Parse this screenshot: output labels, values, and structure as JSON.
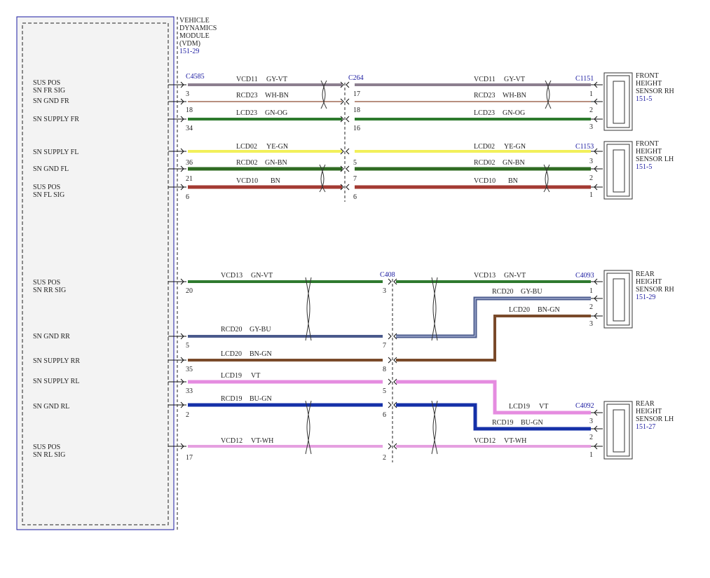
{
  "module": {
    "lines": [
      "VEHICLE",
      "DYNAMICS",
      "MODULE",
      "(VDM)"
    ],
    "ref": "151-29",
    "pins": [
      {
        "label1": "SUS POS",
        "label2": "SN FR SIG"
      },
      {
        "label1": "SN GND FR",
        "label2": ""
      },
      {
        "label1": "SN SUPPLY FR",
        "label2": ""
      },
      {
        "label1": "SN SUPPLY FL",
        "label2": ""
      },
      {
        "label1": "SN GND FL",
        "label2": ""
      },
      {
        "label1": "SUS POS",
        "label2": "SN FL SIG"
      },
      {
        "label1": "SUS POS",
        "label2": "SN RR SIG"
      },
      {
        "label1": "SN GND RR",
        "label2": ""
      },
      {
        "label1": "SN SUPPLY RR",
        "label2": ""
      },
      {
        "label1": "SN SUPPLY RL",
        "label2": ""
      },
      {
        "label1": "SN GND RL",
        "label2": ""
      },
      {
        "label1": "SUS POS",
        "label2": "SN RL SIG"
      }
    ]
  },
  "connectors": {
    "vdm": "C4585",
    "front_inline": "C264",
    "rear_inline": "C408",
    "front_rh": "C1151",
    "front_lh": "C1153",
    "rear_rh": "C4093",
    "rear_lh": "C4092"
  },
  "sensors": [
    {
      "lines": [
        "FRONT",
        "HEIGHT",
        "SENSOR RH"
      ],
      "ref": "151-5"
    },
    {
      "lines": [
        "FRONT",
        "HEIGHT",
        "SENSOR LH"
      ],
      "ref": "151-5"
    },
    {
      "lines": [
        "REAR",
        "HEIGHT",
        "SENSOR RH"
      ],
      "ref": "151-29"
    },
    {
      "lines": [
        "REAR",
        "HEIGHT",
        "SENSOR LH"
      ],
      "ref": "151-27"
    }
  ],
  "circuits": [
    {
      "circuit": "VCD11",
      "color": "GY-VT",
      "hex": "#8c7f8f",
      "vdm_pin": "3",
      "inline_pin": "17",
      "sensor_pin": "1"
    },
    {
      "circuit": "RCD23",
      "color": "WH-BN",
      "hex": "#a06a55",
      "vdm_pin": "18",
      "inline_pin": "18",
      "sensor_pin": "2"
    },
    {
      "circuit": "LCD23",
      "color": "GN-OG",
      "hex": "#2d7a2d",
      "vdm_pin": "34",
      "inline_pin": "16",
      "sensor_pin": "3"
    },
    {
      "circuit": "LCD02",
      "color": "YE-GN",
      "hex": "#f2f05a",
      "vdm_pin": "",
      "inline_pin": "",
      "sensor_pin": "3"
    },
    {
      "circuit": "RCD02",
      "color": "GN-BN",
      "hex": "#2f6b22",
      "vdm_pin": "36",
      "inline_pin": "5",
      "sensor_pin": "2"
    },
    {
      "circuit": "VCD10",
      "color": "BN",
      "hex": "#a33a32",
      "vdm_pin": "21",
      "inline_pin": "7",
      "sensor_pin": "1"
    },
    {
      "circuit": "VCD13",
      "color": "GN-VT",
      "hex": "#2f7a2f",
      "vdm_pin": "20",
      "inline_pin": "3",
      "sensor_pin": "1"
    },
    {
      "circuit": "RCD20",
      "color": "GY-BU",
      "hex": "#4a5a8c",
      "vdm_pin": "5",
      "inline_pin": "7",
      "sensor_pin": "2"
    },
    {
      "circuit": "LCD20",
      "color": "BN-GN",
      "hex": "#7a4a2a",
      "vdm_pin": "35",
      "inline_pin": "8",
      "sensor_pin": "3"
    },
    {
      "circuit": "LCD19",
      "color": "VT",
      "hex": "#e58ce0",
      "vdm_pin": "33",
      "inline_pin": "5",
      "sensor_pin": "3"
    },
    {
      "circuit": "RCD19",
      "color": "BU-GN",
      "hex": "#1530a8",
      "vdm_pin": "2",
      "inline_pin": "6",
      "sensor_pin": "2"
    },
    {
      "circuit": "VCD12",
      "color": "VT-WH",
      "hex": "#e5a0e0",
      "vdm_pin": "17",
      "inline_pin": "2",
      "sensor_pin": "1"
    }
  ],
  "extra_pins": {
    "fl_supply_vdm": "6",
    "fl_supply_inline": "6"
  }
}
